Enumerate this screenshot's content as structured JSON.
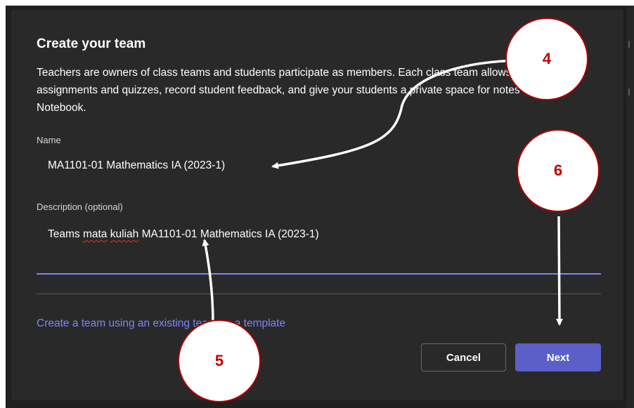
{
  "dialog": {
    "title": "Create your team",
    "description": "Teachers are owners of class teams and students participate as members. Each class team allows you to create assignments and quizzes, record student feedback, and give your students a private space for notes in Class Notebook.",
    "name_label": "Name",
    "name_value": "MA1101-01 Mathematics IA (2023-1)",
    "description_label": "Description (optional)",
    "description_value": {
      "word1": "Teams",
      "word2": "mata",
      "word3": "kuliah",
      "rest": "MA1101-01 Mathematics IA (2023-1)"
    },
    "template_link": "Create a team using an existing team as a template",
    "cancel_label": "Cancel",
    "next_label": "Next"
  },
  "annotations": {
    "step4": "4",
    "step5": "5",
    "step6": "6"
  },
  "colors": {
    "accent": "#5b5fc7",
    "link": "#7f85f5",
    "annotation_border": "#b00000",
    "annotation_text": "#c00000"
  }
}
